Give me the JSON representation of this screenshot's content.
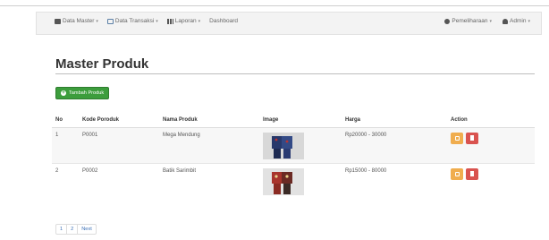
{
  "navbar": {
    "left": [
      {
        "label": "Data Master",
        "caret": "▾",
        "icon": "database-icon"
      },
      {
        "label": "Data Transaksi",
        "caret": "▾",
        "icon": "transfer-icon"
      },
      {
        "label": "Laporan",
        "caret": "▾",
        "icon": "bar-chart-icon"
      },
      {
        "label": "Dashboard",
        "caret": "",
        "icon": ""
      }
    ],
    "right": [
      {
        "label": "Pemeliharaan",
        "caret": "▾",
        "icon": "gear-icon"
      },
      {
        "label": "Admin",
        "caret": "▾",
        "icon": "user-icon"
      }
    ]
  },
  "page": {
    "title": "Master Produk",
    "add_button": "Tambah Produk",
    "add_icon": "plus-circle-icon"
  },
  "table": {
    "headers": [
      "No",
      "Kode Poroduk",
      "Nama Produk",
      "Image",
      "Harga",
      "Action"
    ],
    "rows": [
      {
        "no": "1",
        "kode": "P0001",
        "nama": "Mega Mendung",
        "image": "batik-couple-blue",
        "harga": "Rp20000 - 30000"
      },
      {
        "no": "2",
        "kode": "P0002",
        "nama": "Batik Sarimbit",
        "image": "batik-couple-red",
        "harga": "Rp15000 - 80000"
      }
    ],
    "actions": {
      "edit_icon": "edit-icon",
      "delete_icon": "trash-icon",
      "edit_color": "#f0ad4e",
      "delete_color": "#d9534f"
    }
  },
  "pagination": [
    "1",
    "2",
    "Next"
  ],
  "colors": {
    "primary": "#3c9d3c",
    "link": "#3b6fb6"
  }
}
